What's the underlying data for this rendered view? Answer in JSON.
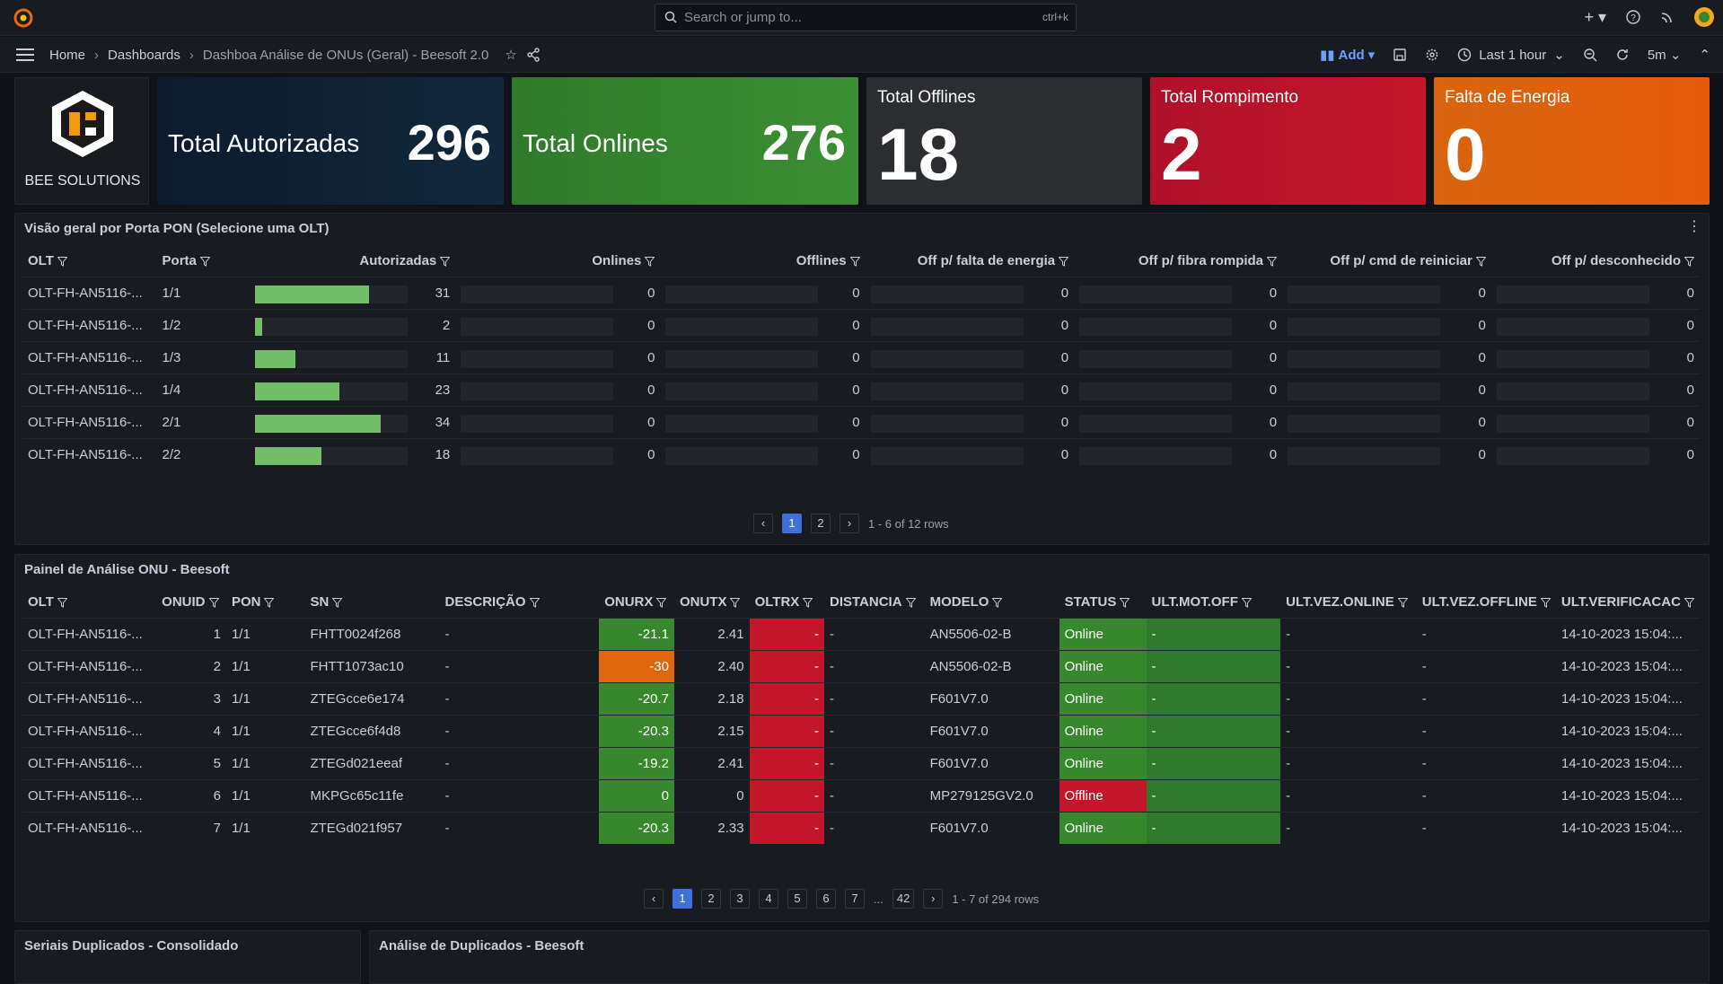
{
  "top": {
    "search_placeholder": "Search or jump to...",
    "shortcut": "ctrl+k"
  },
  "nav": {
    "home": "Home",
    "dashboards": "Dashboards",
    "current": "Dashboa Análise de ONUs (Geral) - Beesoft 2.0",
    "add": "Add",
    "time_range": "Last 1 hour",
    "refresh": "5m"
  },
  "brand": {
    "name": "BEE SOLUTIONS"
  },
  "stats": [
    {
      "label": "Total Autorizadas",
      "value": "296",
      "color": "#0f1d33"
    },
    {
      "label": "Total Onlines",
      "value": "276",
      "color": "#37872d"
    },
    {
      "label": "Total Offlines",
      "value": "18",
      "color": "#2b2d31"
    },
    {
      "label": "Total Rompimento",
      "value": "2",
      "color": "#b4122a"
    },
    {
      "label": "Falta de Energia",
      "value": "0",
      "color": "#e0670e"
    }
  ],
  "pon": {
    "title": "Visão geral por Porta PON (Selecione uma OLT)",
    "headers": [
      "OLT",
      "Porta",
      "Autorizadas",
      "Onlines",
      "Offlines",
      "Off p/ falta de energia",
      "Off p/ fibra rompida",
      "Off p/ cmd de reiniciar",
      "Off p/ desconhecido"
    ],
    "max": 34,
    "rows": [
      {
        "olt": "OLT-FH-AN5116-...",
        "porta": "1/1",
        "vals": [
          31,
          0,
          0,
          0,
          0,
          0,
          0
        ]
      },
      {
        "olt": "OLT-FH-AN5116-...",
        "porta": "1/2",
        "vals": [
          2,
          0,
          0,
          0,
          0,
          0,
          0
        ]
      },
      {
        "olt": "OLT-FH-AN5116-...",
        "porta": "1/3",
        "vals": [
          11,
          0,
          0,
          0,
          0,
          0,
          0
        ]
      },
      {
        "olt": "OLT-FH-AN5116-...",
        "porta": "1/4",
        "vals": [
          23,
          0,
          0,
          0,
          0,
          0,
          0
        ]
      },
      {
        "olt": "OLT-FH-AN5116-...",
        "porta": "2/1",
        "vals": [
          34,
          0,
          0,
          0,
          0,
          0,
          0
        ]
      },
      {
        "olt": "OLT-FH-AN5116-...",
        "porta": "2/2",
        "vals": [
          18,
          0,
          0,
          0,
          0,
          0,
          0
        ]
      }
    ],
    "pages": [
      "1",
      "2"
    ],
    "rows_info": "1 - 6 of 12 rows"
  },
  "onu": {
    "title": "Painel de Análise ONU - Beesoft",
    "headers": [
      "OLT",
      "ONUID",
      "PON",
      "SN",
      "DESCRIÇÃO",
      "ONURX",
      "ONUTX",
      "OLTRX",
      "DISTANCIA",
      "MODELO",
      "STATUS",
      "ULT.MOT.OFF",
      "ULT.VEZ.ONLINE",
      "ULT.VEZ.OFFLINE",
      "ULT.VERIFICACAC"
    ],
    "rows": [
      {
        "olt": "OLT-FH-AN5116-...",
        "onuid": "1",
        "pon": "1/1",
        "sn": "FHTT0024f268",
        "desc": "-",
        "onurx": "-21.1",
        "onurx_c": "cg",
        "onutx": "2.41",
        "oltrx": "-",
        "dist": "-",
        "modelo": "AN5506-02-B",
        "status": "Online",
        "status_c": "cg",
        "motoff": "-",
        "vezon": "-",
        "vezoff": "-",
        "verif": "14-10-2023 15:04:..."
      },
      {
        "olt": "OLT-FH-AN5116-...",
        "onuid": "2",
        "pon": "1/1",
        "sn": "FHTT1073ac10",
        "desc": "-",
        "onurx": "-30",
        "onurx_c": "co",
        "onutx": "2.40",
        "oltrx": "-",
        "dist": "-",
        "modelo": "AN5506-02-B",
        "status": "Online",
        "status_c": "cg",
        "motoff": "-",
        "vezon": "-",
        "vezoff": "-",
        "verif": "14-10-2023 15:04:..."
      },
      {
        "olt": "OLT-FH-AN5116-...",
        "onuid": "3",
        "pon": "1/1",
        "sn": "ZTEGcce6e174",
        "desc": "-",
        "onurx": "-20.7",
        "onurx_c": "cg",
        "onutx": "2.18",
        "oltrx": "-",
        "dist": "-",
        "modelo": "F601V7.0",
        "status": "Online",
        "status_c": "cg",
        "motoff": "-",
        "vezon": "-",
        "vezoff": "-",
        "verif": "14-10-2023 15:04:..."
      },
      {
        "olt": "OLT-FH-AN5116-...",
        "onuid": "4",
        "pon": "1/1",
        "sn": "ZTEGcce6f4d8",
        "desc": "-",
        "onurx": "-20.3",
        "onurx_c": "cg",
        "onutx": "2.15",
        "oltrx": "-",
        "dist": "-",
        "modelo": "F601V7.0",
        "status": "Online",
        "status_c": "cg",
        "motoff": "-",
        "vezon": "-",
        "vezoff": "-",
        "verif": "14-10-2023 15:04:..."
      },
      {
        "olt": "OLT-FH-AN5116-...",
        "onuid": "5",
        "pon": "1/1",
        "sn": "ZTEGd021eeaf",
        "desc": "-",
        "onurx": "-19.2",
        "onurx_c": "cg",
        "onutx": "2.41",
        "oltrx": "-",
        "dist": "-",
        "modelo": "F601V7.0",
        "status": "Online",
        "status_c": "cg",
        "motoff": "-",
        "vezon": "-",
        "vezoff": "-",
        "verif": "14-10-2023 15:04:..."
      },
      {
        "olt": "OLT-FH-AN5116-...",
        "onuid": "6",
        "pon": "1/1",
        "sn": "MKPGc65c11fe",
        "desc": "-",
        "onurx": "0",
        "onurx_c": "cg",
        "onutx": "0",
        "oltrx": "-",
        "dist": "-",
        "modelo": "MP279125GV2.0",
        "status": "Offline",
        "status_c": "cr",
        "motoff": "-",
        "vezon": "-",
        "vezoff": "-",
        "verif": "14-10-2023 15:04:..."
      },
      {
        "olt": "OLT-FH-AN5116-...",
        "onuid": "7",
        "pon": "1/1",
        "sn": "ZTEGd021f957",
        "desc": "-",
        "onurx": "-20.3",
        "onurx_c": "cg",
        "onutx": "2.33",
        "oltrx": "-",
        "dist": "-",
        "modelo": "F601V7.0",
        "status": "Online",
        "status_c": "cg",
        "motoff": "-",
        "vezon": "-",
        "vezoff": "-",
        "verif": "14-10-2023 15:04:..."
      }
    ],
    "pages": [
      "1",
      "2",
      "3",
      "4",
      "5",
      "6",
      "7",
      "...",
      "42"
    ],
    "rows_info": "1 - 7 of 294 rows"
  },
  "bottom": {
    "left_title": "Seriais Duplicados - Consolidado",
    "right_title": "Análise de Duplicados - Beesoft"
  }
}
